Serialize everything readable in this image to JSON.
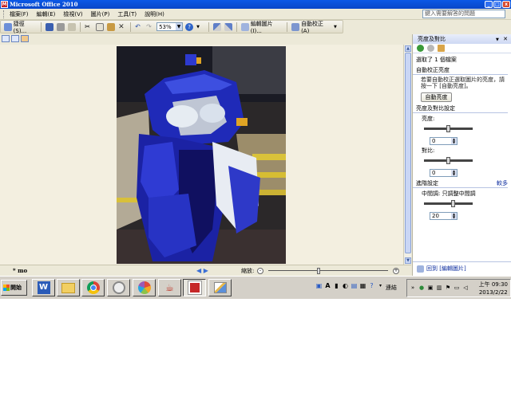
{
  "window": {
    "title": "Microsoft Office 2010",
    "app_icon_letter": "M",
    "minimize": "_",
    "maximize": "□",
    "close": "x"
  },
  "menu": {
    "items": [
      "檔案(F)",
      "編輯(E)",
      "檢視(V)",
      "圖片(P)",
      "工具(T)",
      "說明(H)"
    ],
    "help_placeholder": "鍵入需要解答的問題"
  },
  "toolbar": {
    "shortcuts_label": "捷徑(S)...",
    "zoom_value": "53%",
    "edit_pictures_label": "編輯圖片(I)...",
    "auto_correct_label": "自動校正(A)"
  },
  "status": {
    "file_name": "* mo",
    "zoom_label": "縮放:",
    "prev": "◀",
    "next": "▶",
    "zoom_level": 0.42
  },
  "taskpane": {
    "title": "亮度及對比",
    "selected_count": "選取了 1 個檔案",
    "auto_brightness_section": "自動校正亮度",
    "auto_brightness_desc": "若要自動校正選取圖片的亮度，請按一下 [自動亮度]。",
    "auto_brightness_button": "自動亮度",
    "settings_section": "亮度及對比設定",
    "brightness_label": "亮度:",
    "brightness_value": "0",
    "brightness_level": 0.5,
    "contrast_label": "對比:",
    "contrast_value": "0",
    "contrast_level": 0.5,
    "advanced_section": "進階設定",
    "more_link": "較多",
    "midtone_label": "中間調: 只調整中間調",
    "midtone_value": "20",
    "midtone_level": 0.6,
    "back_link": "回到 [編輯圖片]"
  },
  "taskbar": {
    "start_label": "開始",
    "links_label": "連結",
    "clock_time": "上午 09:30",
    "clock_date": "2013/2/22",
    "apps": [
      "word",
      "explorer",
      "chrome",
      "system-check",
      "picasa",
      "java",
      "picture-manager",
      "paint"
    ]
  },
  "colors": {
    "title_bar": "#0a58e6",
    "chrome_bg": "#ece9d8",
    "accent_link": "#0b2b9e",
    "scooter_blue": "#1f2ab8"
  }
}
